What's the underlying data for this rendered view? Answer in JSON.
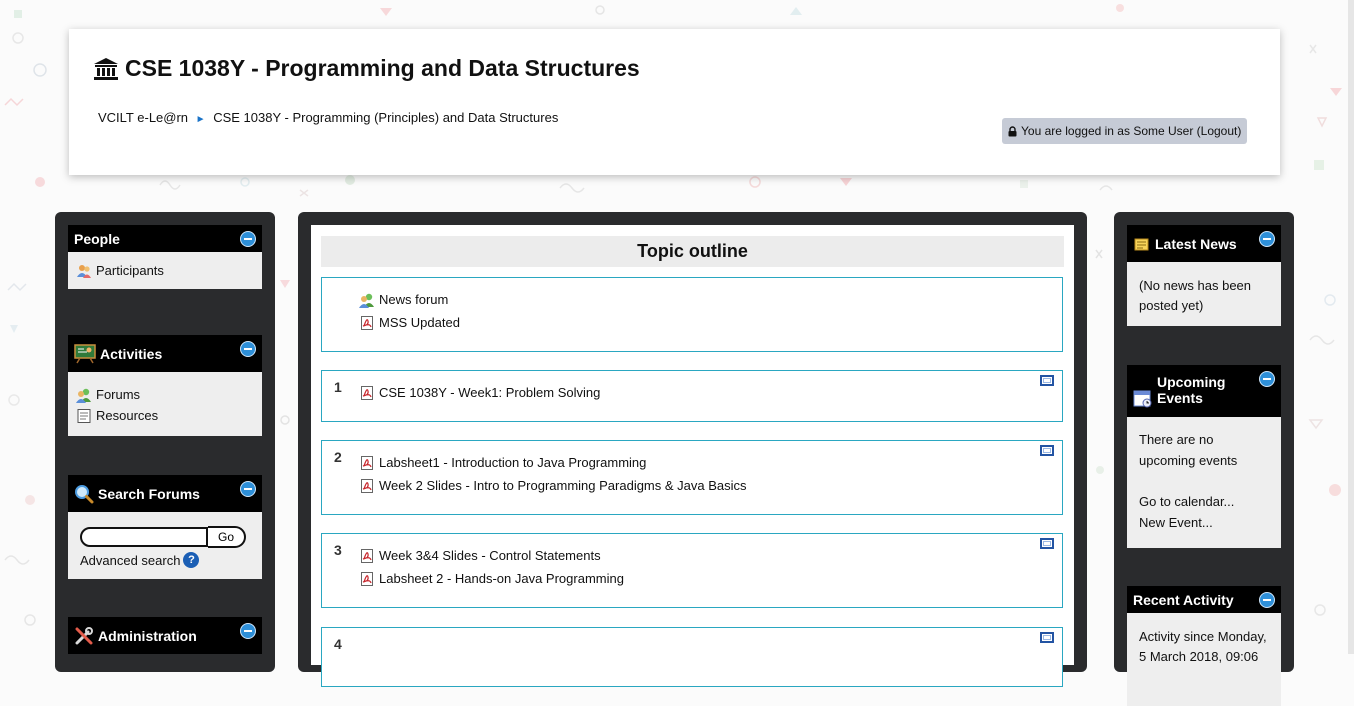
{
  "header": {
    "course_title": "CSE 1038Y - Programming and Data Structures",
    "breadcrumb": {
      "home": "VCILT e-Le@rn",
      "current": "CSE 1038Y - Programming (Principles) and Data Structures"
    },
    "login_text": "You are logged in as Some User (Logout)"
  },
  "left_blocks": {
    "people": {
      "title": "People",
      "items": [
        "Participants"
      ]
    },
    "activities": {
      "title": "Activities",
      "items": [
        "Forums",
        "Resources"
      ]
    },
    "search": {
      "title": "Search Forums",
      "input_value": "",
      "go_label": "Go",
      "advanced_label": "Advanced search",
      "help_glyph": "?"
    },
    "administration": {
      "title": "Administration"
    }
  },
  "main": {
    "title": "Topic outline",
    "sections": [
      {
        "number": "",
        "items": [
          "News forum",
          "MSS Updated"
        ]
      },
      {
        "number": "1",
        "items": [
          "CSE 1038Y - Week1: Problem Solving"
        ]
      },
      {
        "number": "2",
        "items": [
          "Labsheet1 - Introduction to Java Programming",
          "Week 2 Slides - Intro to Programming Paradigms & Java Basics"
        ]
      },
      {
        "number": "3",
        "items": [
          "Week 3&4 Slides - Control Statements",
          "Labsheet 2 - Hands-on Java Programming"
        ]
      },
      {
        "number": "4",
        "items": []
      }
    ]
  },
  "right_blocks": {
    "latest_news": {
      "title": "Latest News",
      "body": "(No news has been posted yet)"
    },
    "upcoming_events": {
      "title_line1": "Upcoming",
      "title_line2": "Events",
      "body": "There are no upcoming events",
      "link1": "Go to calendar...",
      "link2": "New Event..."
    },
    "recent_activity": {
      "title": "Recent Activity",
      "body": "Activity since Monday, 5 March 2018, 09:06"
    }
  },
  "icons": {
    "title": "institution-icon",
    "lock": "lock-icon",
    "participants": "participants-icon",
    "activities": "chalkboard-icon",
    "forums": "forum-icon",
    "resources": "document-icon",
    "search": "magnifier-icon",
    "admin": "tools-icon",
    "pdf": "pdf-icon",
    "news": "news-icon",
    "calendar": "calendar-icon",
    "collapse": "collapse-icon"
  },
  "colors": {
    "section_border": "#2aa7c1",
    "block_head": "#000000",
    "collapse_blue": "#2e8fd8",
    "login_badge": "#c6cbd6"
  }
}
